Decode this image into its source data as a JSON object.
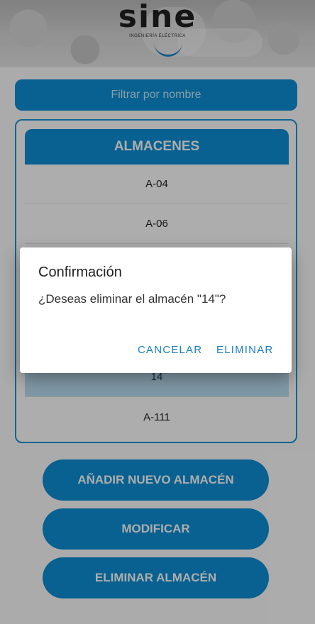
{
  "brand": {
    "name": "sine",
    "tagline": "INGENIERÍA ELÉCTRICA"
  },
  "filter": {
    "placeholder": "Filtrar por nombre"
  },
  "list": {
    "header": "ALMACENES",
    "items": [
      {
        "label": "A-04"
      },
      {
        "label": "A-06"
      },
      {
        "label": ""
      },
      {
        "label": ""
      },
      {
        "label": ""
      },
      {
        "label": "14",
        "selected": true
      },
      {
        "label": "A-111"
      }
    ]
  },
  "buttons": {
    "add": "AÑADIR NUEVO ALMACÉN",
    "modify": "MODIFICAR",
    "delete": "ELIMINAR ALMACÉN"
  },
  "dialog": {
    "title": "Confirmación",
    "message": "¿Deseas eliminar el almacén \"14\"?",
    "cancel": "CANCELAR",
    "confirm": "ELIMINAR"
  },
  "colors": {
    "primary": "#0d8fd4",
    "selected_row": "#bfe2f5",
    "dialog_action": "#1a7fc0"
  }
}
